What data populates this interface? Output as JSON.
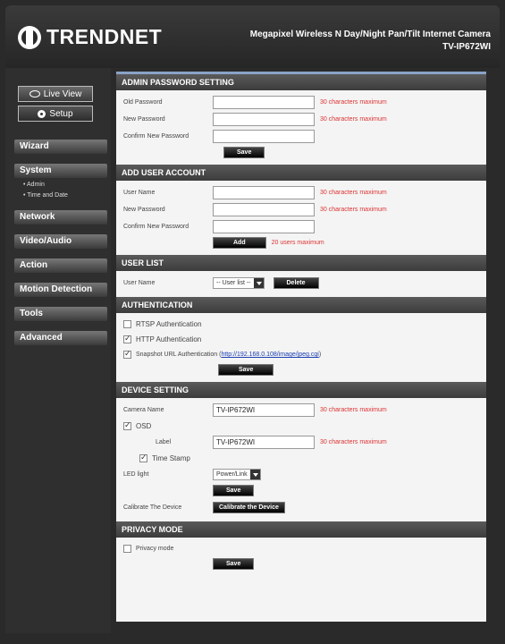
{
  "header": {
    "brand": "TRENDNET",
    "product_title": "Megapixel Wireless N Day/Night Pan/Tilt Internet Camera",
    "model": "TV-IP672WI"
  },
  "view_buttons": {
    "live_view": "Live View",
    "setup": "Setup"
  },
  "menu": {
    "wizard": "Wizard",
    "system": "System",
    "system_sub": [
      "• Admin",
      "• Time and Date"
    ],
    "network": "Network",
    "video_audio": "Video/Audio",
    "action": "Action",
    "motion_detection": "Motion Detection",
    "tools": "Tools",
    "advanced": "Advanced"
  },
  "admin_password": {
    "title": "ADMIN PASSWORD SETTING",
    "old_label": "Old Password",
    "new_label": "New Password",
    "confirm_label": "Confirm New Password",
    "hint": "30 characters maximum",
    "save": "Save"
  },
  "add_user": {
    "title": "ADD USER ACCOUNT",
    "user_label": "User Name",
    "new_label": "New Password",
    "confirm_label": "Confirm New Password",
    "hint": "30 characters maximum",
    "add": "Add",
    "users_max": "20 users maximum"
  },
  "user_list": {
    "title": "USER LIST",
    "label": "User Name",
    "selected": "-- User list --",
    "delete": "Delete"
  },
  "authentication": {
    "title": "AUTHENTICATION",
    "rtsp": "RTSP Authentication",
    "http": "HTTP Authentication",
    "snapshot": "Snapshot URL Authentication (",
    "snapshot_url": "http://192.168.0.108/image/jpeg.cgi",
    "snapshot_end": ")",
    "save": "Save",
    "rtsp_checked": false,
    "http_checked": true,
    "snapshot_checked": true
  },
  "device": {
    "title": "DEVICE SETTING",
    "camera_label": "Camera Name",
    "camera_value": "TV-IP672WI",
    "hint": "30 characters maximum",
    "osd": "OSD",
    "label_label": "Label",
    "label_value": "TV-IP672WI",
    "time_stamp": "Time Stamp",
    "led_label": "LED light",
    "led_value": "Power/Link",
    "save": "Save",
    "calibrate_label": "Calibrate The Device",
    "calibrate_btn": "Calibrate the Device",
    "osd_checked": true,
    "time_stamp_checked": true
  },
  "privacy": {
    "title": "PRIVACY MODE",
    "mode": "Privacy mode",
    "save": "Save",
    "mode_checked": false
  }
}
